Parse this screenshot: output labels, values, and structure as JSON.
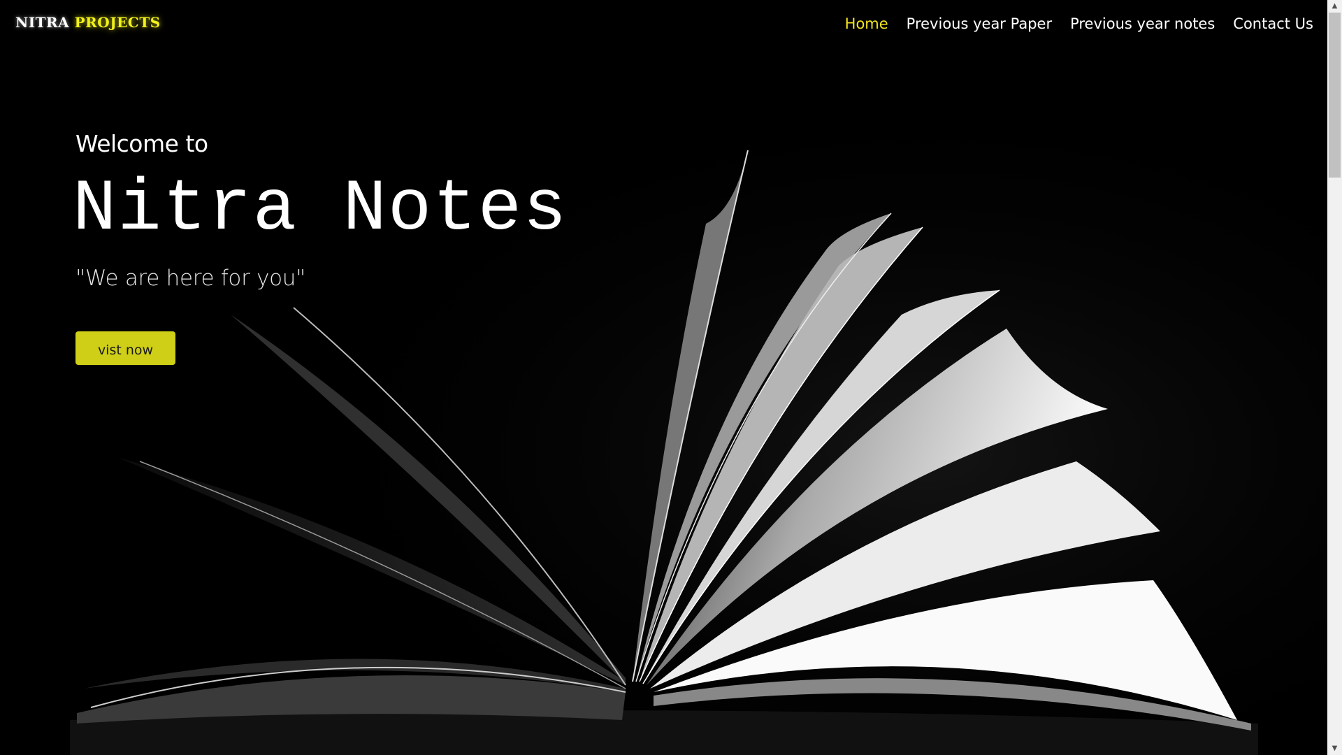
{
  "brand": {
    "part1": "NITRA",
    "part2": "PROJECTS"
  },
  "nav": {
    "items": [
      {
        "label": "Home",
        "active": true
      },
      {
        "label": "Previous year Paper",
        "active": false
      },
      {
        "label": "Previous year notes",
        "active": false
      },
      {
        "label": "Contact Us",
        "active": false
      }
    ]
  },
  "hero": {
    "welcome": "Welcome to",
    "title": "Nitra Notes",
    "tagline": "\"We are here for you\"",
    "cta_label": "vist now"
  },
  "colors": {
    "background": "#000000",
    "accent": "#f2e41b",
    "button": "#cfcf18"
  },
  "icons": {
    "scroll_up": "chevron-up-icon",
    "scroll_down": "chevron-down-icon"
  }
}
